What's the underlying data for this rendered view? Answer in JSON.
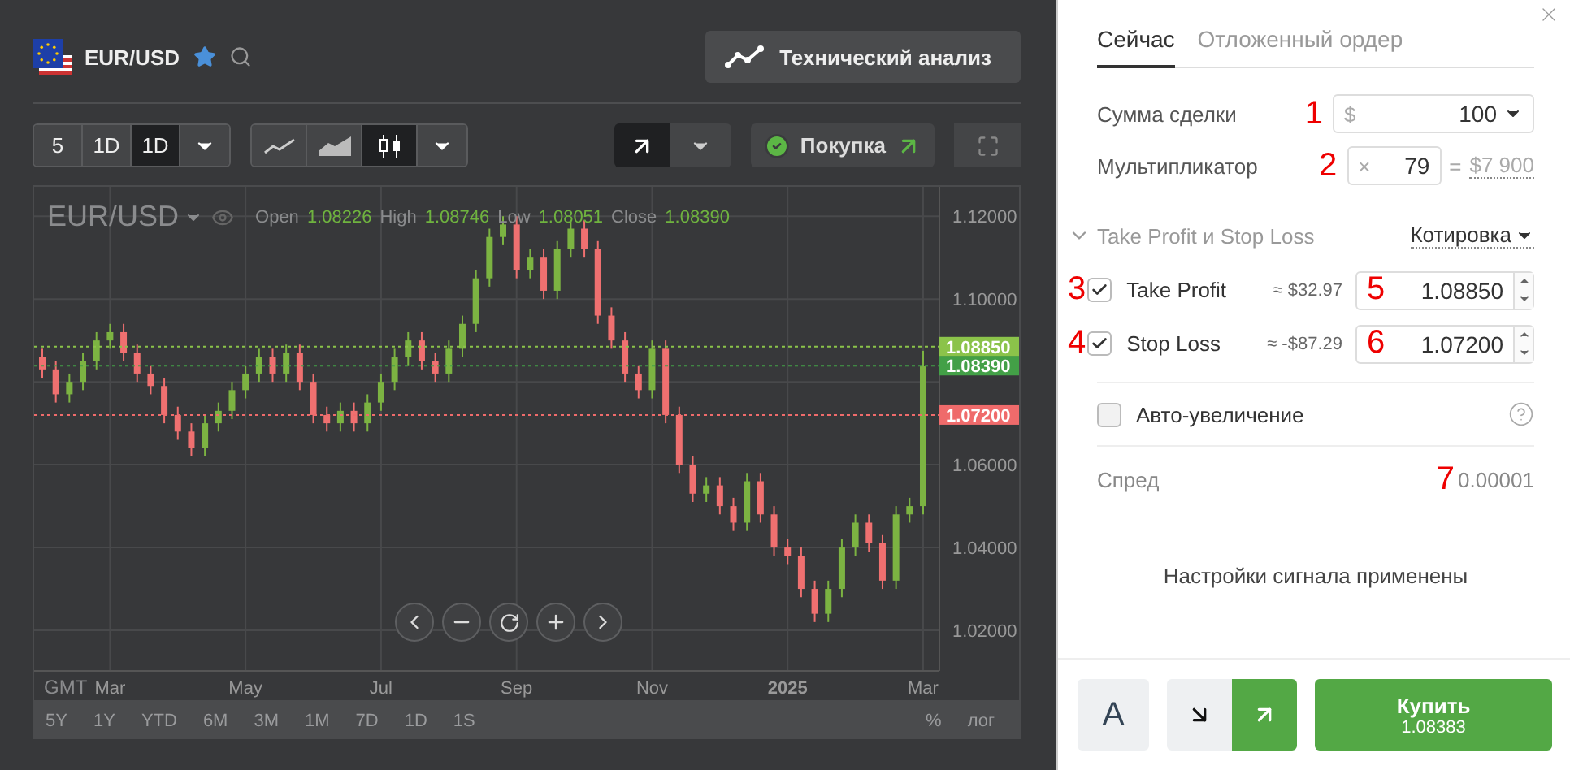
{
  "instrument": {
    "symbol": "EUR/USD",
    "favorite": true
  },
  "analysis_button": {
    "label": "Технический анализ"
  },
  "toolbar": {
    "timeframes": [
      {
        "label": "5",
        "selected": false
      },
      {
        "label": "1D",
        "selected": false
      },
      {
        "label": "1D",
        "selected": true
      }
    ],
    "chart_types": [
      {
        "kind": "line",
        "selected": false
      },
      {
        "kind": "area",
        "selected": false
      },
      {
        "kind": "candles",
        "selected": true
      }
    ],
    "direction": {
      "kind": "up"
    },
    "signal": {
      "label": "Покупка"
    }
  },
  "chart": {
    "symbol": "EUR/USD",
    "ohlc": [
      {
        "label": "Open",
        "value": "1.08226"
      },
      {
        "label": "High",
        "value": "1.08746"
      },
      {
        "label": "Low",
        "value": "1.08051"
      },
      {
        "label": "Close",
        "value": "1.08390"
      }
    ],
    "timezone": "GMT",
    "chart_data": {
      "type": "candlestick",
      "ylim": [
        1.0102,
        1.1271
      ],
      "grid": true,
      "categories": [
        null,
        null,
        null,
        null,
        null,
        "Mar",
        null,
        null,
        null,
        null,
        null,
        null,
        null,
        null,
        null,
        "May",
        null,
        null,
        null,
        null,
        null,
        null,
        null,
        null,
        null,
        "Jul",
        null,
        null,
        null,
        null,
        null,
        null,
        null,
        null,
        null,
        "Sep",
        null,
        null,
        null,
        null,
        null,
        null,
        null,
        null,
        null,
        "Nov",
        null,
        null,
        null,
        null,
        null,
        null,
        null,
        null,
        null,
        "2025",
        null,
        null,
        null,
        null,
        null,
        null,
        null,
        null,
        null,
        "Mar"
      ],
      "ohlc": [
        [
          1.086,
          1.088,
          1.081,
          1.083
        ],
        [
          1.083,
          1.085,
          1.075,
          1.077
        ],
        [
          1.077,
          1.082,
          1.075,
          1.08
        ],
        [
          1.08,
          1.087,
          1.078,
          1.085
        ],
        [
          1.085,
          1.092,
          1.083,
          1.09
        ],
        [
          1.09,
          1.094,
          1.088,
          1.092
        ],
        [
          1.092,
          1.094,
          1.085,
          1.087
        ],
        [
          1.087,
          1.089,
          1.08,
          1.082
        ],
        [
          1.082,
          1.084,
          1.077,
          1.079
        ],
        [
          1.079,
          1.081,
          1.07,
          1.072
        ],
        [
          1.072,
          1.074,
          1.066,
          1.068
        ],
        [
          1.068,
          1.07,
          1.062,
          1.064
        ],
        [
          1.064,
          1.072,
          1.062,
          1.07
        ],
        [
          1.07,
          1.075,
          1.068,
          1.073
        ],
        [
          1.073,
          1.08,
          1.071,
          1.078
        ],
        [
          1.078,
          1.084,
          1.076,
          1.082
        ],
        [
          1.082,
          1.088,
          1.08,
          1.086
        ],
        [
          1.086,
          1.088,
          1.08,
          1.082
        ],
        [
          1.082,
          1.089,
          1.08,
          1.087
        ],
        [
          1.087,
          1.089,
          1.078,
          1.08
        ],
        [
          1.08,
          1.082,
          1.07,
          1.072
        ],
        [
          1.072,
          1.074,
          1.068,
          1.07
        ],
        [
          1.07,
          1.075,
          1.068,
          1.073
        ],
        [
          1.073,
          1.075,
          1.068,
          1.07
        ],
        [
          1.07,
          1.077,
          1.068,
          1.075
        ],
        [
          1.075,
          1.082,
          1.073,
          1.08
        ],
        [
          1.08,
          1.088,
          1.078,
          1.086
        ],
        [
          1.086,
          1.092,
          1.084,
          1.09
        ],
        [
          1.09,
          1.092,
          1.083,
          1.085
        ],
        [
          1.085,
          1.087,
          1.08,
          1.082
        ],
        [
          1.082,
          1.09,
          1.08,
          1.088
        ],
        [
          1.088,
          1.096,
          1.086,
          1.094
        ],
        [
          1.094,
          1.107,
          1.092,
          1.105
        ],
        [
          1.105,
          1.117,
          1.103,
          1.115
        ],
        [
          1.115,
          1.12,
          1.113,
          1.118
        ],
        [
          1.118,
          1.12,
          1.105,
          1.107
        ],
        [
          1.107,
          1.112,
          1.105,
          1.11
        ],
        [
          1.11,
          1.112,
          1.1,
          1.102
        ],
        [
          1.102,
          1.114,
          1.1,
          1.112
        ],
        [
          1.112,
          1.119,
          1.11,
          1.117
        ],
        [
          1.117,
          1.119,
          1.11,
          1.112
        ],
        [
          1.112,
          1.114,
          1.094,
          1.096
        ],
        [
          1.096,
          1.098,
          1.088,
          1.09
        ],
        [
          1.09,
          1.092,
          1.08,
          1.082
        ],
        [
          1.082,
          1.084,
          1.076,
          1.078
        ],
        [
          1.078,
          1.09,
          1.076,
          1.088
        ],
        [
          1.088,
          1.09,
          1.07,
          1.072
        ],
        [
          1.072,
          1.074,
          1.058,
          1.06
        ],
        [
          1.06,
          1.062,
          1.051,
          1.053
        ],
        [
          1.053,
          1.057,
          1.051,
          1.055
        ],
        [
          1.055,
          1.057,
          1.048,
          1.05
        ],
        [
          1.05,
          1.052,
          1.044,
          1.046
        ],
        [
          1.046,
          1.058,
          1.044,
          1.056
        ],
        [
          1.056,
          1.058,
          1.046,
          1.048
        ],
        [
          1.048,
          1.05,
          1.038,
          1.04
        ],
        [
          1.04,
          1.042,
          1.036,
          1.038
        ],
        [
          1.038,
          1.04,
          1.028,
          1.03
        ],
        [
          1.03,
          1.032,
          1.022,
          1.024
        ],
        [
          1.024,
          1.032,
          1.022,
          1.03
        ],
        [
          1.03,
          1.042,
          1.028,
          1.04
        ],
        [
          1.04,
          1.048,
          1.038,
          1.046
        ],
        [
          1.046,
          1.048,
          1.039,
          1.041
        ],
        [
          1.041,
          1.043,
          1.03,
          1.032
        ],
        [
          1.032,
          1.05,
          1.03,
          1.048
        ],
        [
          1.048,
          1.052,
          1.046,
          1.05
        ],
        [
          1.05,
          1.0875,
          1.048,
          1.0839
        ]
      ],
      "yticks": [
        {
          "value": 1.02,
          "label": "1.02000"
        },
        {
          "value": 1.04,
          "label": "1.04000"
        },
        {
          "value": 1.06,
          "label": "1.06000"
        },
        {
          "value": 1.1,
          "label": "1.10000"
        },
        {
          "value": 1.12,
          "label": "1.12000"
        }
      ],
      "ref_lines": [
        {
          "axis": "y",
          "value": 1.0885,
          "label": "1.08850",
          "color": "#8bc34a"
        },
        {
          "axis": "y",
          "value": 1.0839,
          "label": "1.08390",
          "color": "#43a047"
        },
        {
          "axis": "y",
          "value": 1.072,
          "label": "1.07200",
          "color": "#ef6b6b"
        }
      ]
    },
    "periods": [
      "5Y",
      "1Y",
      "YTD",
      "6M",
      "3M",
      "1M",
      "7D",
      "1D",
      "1S"
    ],
    "scale_options": [
      "%",
      "лог"
    ]
  },
  "trade_panel": {
    "tabs": [
      {
        "label": "Сейчас",
        "selected": true
      },
      {
        "label": "Отложенный ордер",
        "selected": false
      }
    ],
    "amount": {
      "label": "Сумма сделки",
      "currency": "$",
      "value": "100",
      "callout": "1"
    },
    "multiplier": {
      "label": "Мультипликатор",
      "prefix": "×",
      "value": "79",
      "equals": "=",
      "total": "$7 900",
      "callout": "2"
    },
    "tpsl": {
      "title": "Take Profit и Stop Loss",
      "expanded": true,
      "mode": "Котировка",
      "rows": [
        {
          "label": "Take Profit",
          "checked": true,
          "estimate": "≈ $32.97",
          "value": "1.08850",
          "check_callout": "3",
          "value_callout": "5"
        },
        {
          "label": "Stop Loss",
          "checked": true,
          "estimate": "≈ -$87.29",
          "value": "1.07200",
          "check_callout": "4",
          "value_callout": "6"
        }
      ]
    },
    "auto_increase": {
      "label": "Авто-увеличение",
      "checked": false
    },
    "spread": {
      "label": "Спред",
      "value": "0.00001",
      "callout": "7"
    },
    "notice": "Настройки сигнала применены",
    "footer": {
      "auto_button": "A",
      "directions": [
        {
          "kind": "down",
          "selected": false
        },
        {
          "kind": "up",
          "selected": true
        }
      ],
      "buy": {
        "label": "Купить",
        "price": "1.08383"
      }
    }
  }
}
